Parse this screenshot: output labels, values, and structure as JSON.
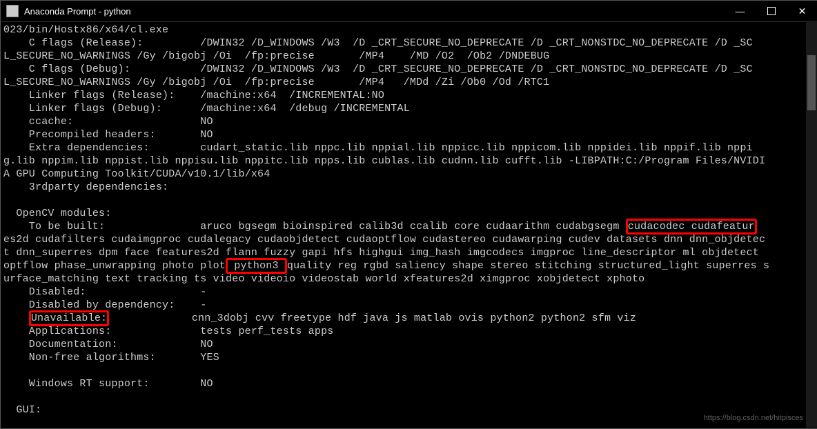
{
  "window": {
    "title": "Anaconda Prompt - python"
  },
  "terminal": {
    "l1": "023/bin/Hostx86/x64/cl.exe",
    "l2": "    C flags (Release):         /DWIN32 /D_WINDOWS /W3  /D _CRT_SECURE_NO_DEPRECATE /D _CRT_NONSTDC_NO_DEPRECATE /D _SC",
    "l3": "L_SECURE_NO_WARNINGS /Gy /bigobj /Oi  /fp:precise       /MP4    /MD /O2  /Ob2 /DNDEBUG",
    "l4": "    C flags (Debug):           /DWIN32 /D_WINDOWS /W3  /D _CRT_SECURE_NO_DEPRECATE /D _CRT_NONSTDC_NO_DEPRECATE /D _SC",
    "l5": "L_SECURE_NO_WARNINGS /Gy /bigobj /Oi  /fp:precise       /MP4   /MDd /Zi /Ob0 /Od /RTC1",
    "l6": "    Linker flags (Release):    /machine:x64  /INCREMENTAL:NO",
    "l7": "    Linker flags (Debug):      /machine:x64  /debug /INCREMENTAL",
    "l8": "    ccache:                    NO",
    "l9": "    Precompiled headers:       NO",
    "l10": "    Extra dependencies:        cudart_static.lib nppc.lib nppial.lib nppicc.lib nppicom.lib nppidei.lib nppif.lib nppi",
    "l11": "g.lib nppim.lib nppist.lib nppisu.lib nppitc.lib npps.lib cublas.lib cudnn.lib cufft.lib -LIBPATH:C:/Program Files/NVIDI",
    "l12": "A GPU Computing Toolkit/CUDA/v10.1/lib/x64",
    "l13": "    3rdparty dependencies:",
    "l14": "",
    "l15": "  OpenCV modules:",
    "l16a": "    To be built:               aruco bgsegm bioinspired calib3d ccalib core cudaarithm cudabgsegm ",
    "l16b": "cudacodec cudafeatur",
    "l17": "es2d cudafilters cudaimgproc cudalegacy cudaobjdetect cudaoptflow cudastereo cudawarping cudev datasets dnn dnn_objdetec",
    "l18": "t dnn_superres dpm face features2d flann fuzzy gapi hfs highgui img_hash imgcodecs imgproc line_descriptor ml objdetect ",
    "l19a": "optflow phase_unwrapping photo plot",
    "l19b": " python3 ",
    "l19c": "quality reg rgbd saliency shape stereo stitching structured_light superres s",
    "l20": "urface_matching text tracking ts video videoio videostab world xfeatures2d ximgproc xobjdetect xphoto",
    "l21": "    Disabled:                  -",
    "l22": "    Disabled by dependency:    -",
    "l23a": "    ",
    "l23b": "Unavailable:",
    "l23c": "             cnn_3dobj cvv freetype hdf java js matlab ovis python2 python2 sfm viz",
    "l24": "    Applications:              tests perf_tests apps",
    "l25": "    Documentation:             NO",
    "l26": "    Non-free algorithms:       YES",
    "l27": "",
    "l28": "    Windows RT support:        NO",
    "l29": "",
    "l30": "  GUI:"
  },
  "watermark": "https://blog.csdn.net/hitpisces"
}
